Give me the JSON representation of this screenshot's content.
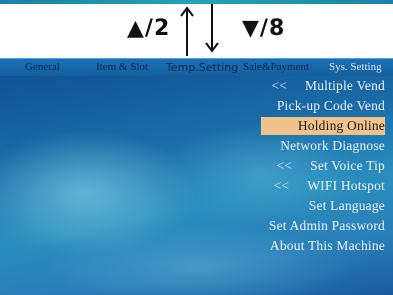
{
  "hint": {
    "up_label": "▲/2",
    "down_label": "▼/8"
  },
  "tabs": [
    {
      "label": "General"
    },
    {
      "label": "Item & Slot"
    },
    {
      "label": "Temp.Setting"
    },
    {
      "label": "Sale&Payment"
    },
    {
      "label": "Sys. Setting"
    }
  ],
  "active_tab": "Sys. Setting",
  "menu": {
    "selected": "Holding Online",
    "items": [
      {
        "mark": "<<",
        "label": "Multiple Vend"
      },
      {
        "mark": "",
        "label": "Pick-up Code Vend"
      },
      {
        "mark": "",
        "label": "Holding Online"
      },
      {
        "mark": "",
        "label": "Network Diagnose"
      },
      {
        "mark": "<<",
        "label": "Set Voice Tip"
      },
      {
        "mark": "<<",
        "label": "WIFI Hotspot"
      },
      {
        "mark": "",
        "label": "Set Language"
      },
      {
        "mark": "",
        "label": "Set Admin Password"
      },
      {
        "mark": "",
        "label": "About This Machine"
      }
    ]
  },
  "colors": {
    "background_top": "#0f4f93",
    "background_mid": "#2a8dbc",
    "selection": "#f2c28c",
    "text": "#e9f3ff"
  }
}
